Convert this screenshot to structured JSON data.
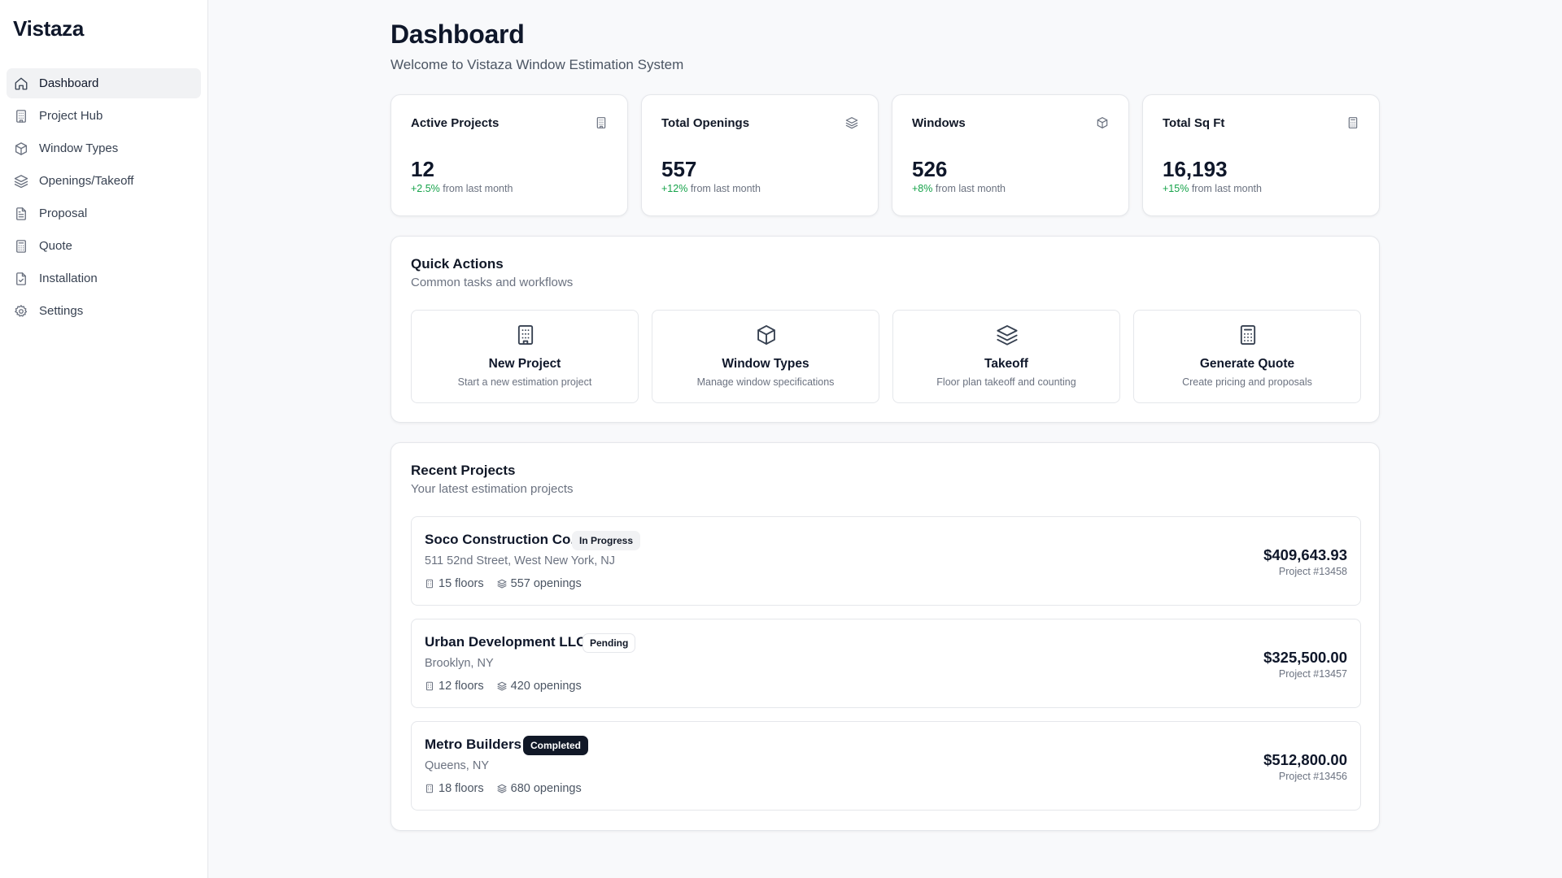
{
  "app": {
    "brand": "Vistaza"
  },
  "sidebar": {
    "items": [
      {
        "label": "Dashboard",
        "icon": "home-icon",
        "active": true
      },
      {
        "label": "Project Hub",
        "icon": "building-icon"
      },
      {
        "label": "Window Types",
        "icon": "box-icon"
      },
      {
        "label": "Openings/Takeoff",
        "icon": "layers-icon"
      },
      {
        "label": "Proposal",
        "icon": "file-text-icon"
      },
      {
        "label": "Quote",
        "icon": "calculator-icon"
      },
      {
        "label": "Installation",
        "icon": "file-check-icon"
      },
      {
        "label": "Settings",
        "icon": "gear-icon"
      }
    ]
  },
  "header": {
    "title": "Dashboard",
    "subtitle": "Welcome to Vistaza Window Estimation System"
  },
  "stats": [
    {
      "title": "Active Projects",
      "value": "12",
      "delta": "+2.5%",
      "suffix": "from last month",
      "icon": "building-icon"
    },
    {
      "title": "Total Openings",
      "value": "557",
      "delta": "+12%",
      "suffix": "from last month",
      "icon": "layers-icon"
    },
    {
      "title": "Windows",
      "value": "526",
      "delta": "+8%",
      "suffix": "from last month",
      "icon": "box-icon"
    },
    {
      "title": "Total Sq Ft",
      "value": "16,193",
      "delta": "+15%",
      "suffix": "from last month",
      "icon": "calculator-icon"
    }
  ],
  "quick_actions": {
    "title": "Quick Actions",
    "subtitle": "Common tasks and workflows",
    "items": [
      {
        "label": "New Project",
        "desc": "Start a new estimation project",
        "icon": "building-icon"
      },
      {
        "label": "Window Types",
        "desc": "Manage window specifications",
        "icon": "box-icon"
      },
      {
        "label": "Takeoff",
        "desc": "Floor plan takeoff and counting",
        "icon": "layers-icon"
      },
      {
        "label": "Generate Quote",
        "desc": "Create pricing and proposals",
        "icon": "calculator-icon"
      }
    ]
  },
  "recent_projects": {
    "title": "Recent Projects",
    "subtitle": "Your latest estimation projects",
    "items": [
      {
        "name": "Soco Construction Co.",
        "status": "In Progress",
        "status_style": "light",
        "address": "511 52nd Street, West New York, NJ",
        "floors": "15 floors",
        "openings": "557 openings",
        "amount": "$409,643.93",
        "project_id": "Project #13458"
      },
      {
        "name": "Urban Development LLC",
        "status": "Pending",
        "status_style": "outline",
        "address": "Brooklyn, NY",
        "floors": "12 floors",
        "openings": "420 openings",
        "amount": "$325,500.00",
        "project_id": "Project #13457"
      },
      {
        "name": "Metro Builders",
        "status": "Completed",
        "status_style": "dark",
        "address": "Queens, NY",
        "floors": "18 floors",
        "openings": "680 openings",
        "amount": "$512,800.00",
        "project_id": "Project #13456"
      }
    ]
  },
  "colors": {
    "background": "#f8f9fb",
    "positive": "#16a34a",
    "text": "#0f172a",
    "muted": "#6b7280",
    "border": "#e5e7eb"
  }
}
